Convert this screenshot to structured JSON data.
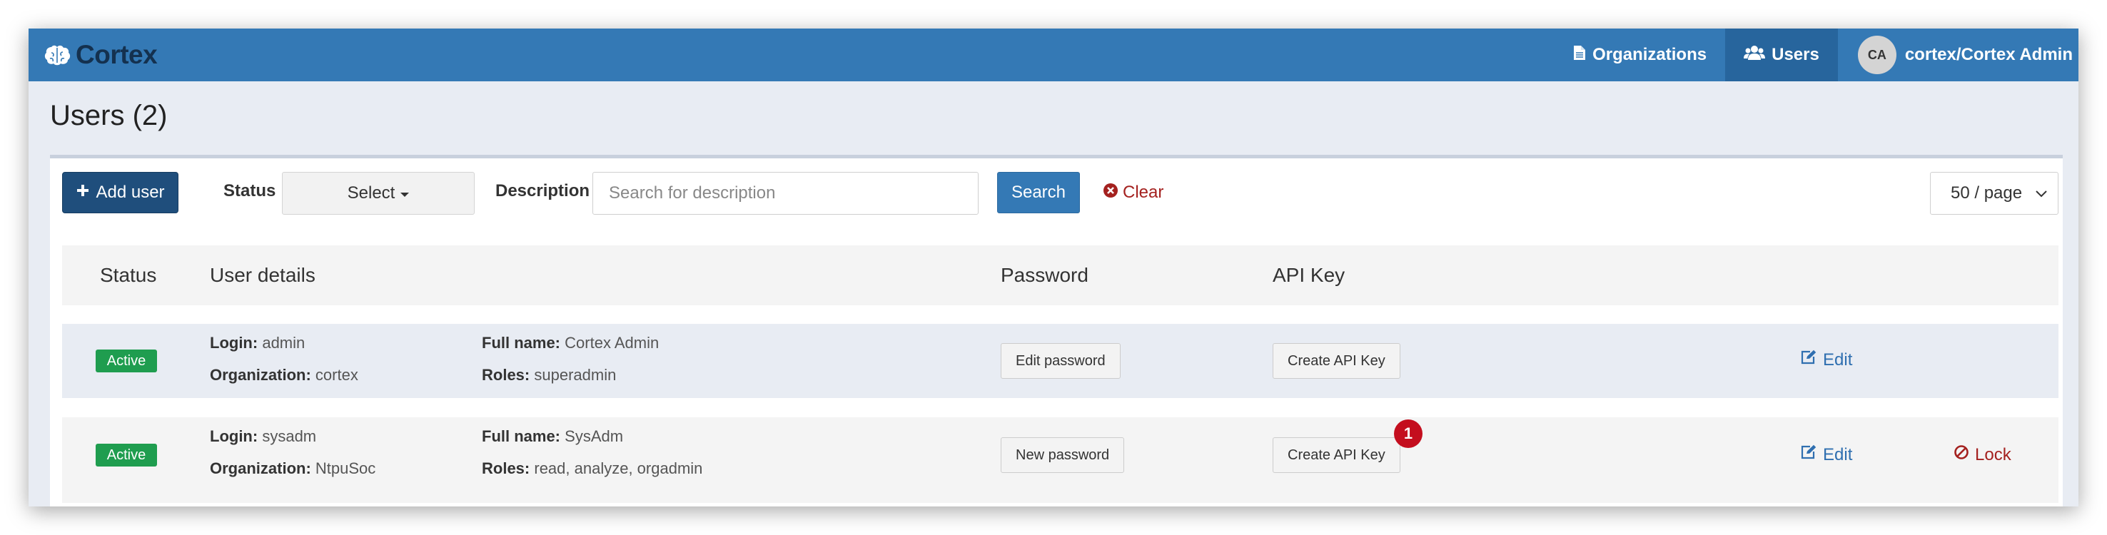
{
  "app": {
    "brand": "Cortex"
  },
  "nav": {
    "organizations": "Organizations",
    "users": "Users",
    "avatar_initials": "CA",
    "user_name": "cortex/Cortex Admin"
  },
  "page": {
    "title": "Users (2)"
  },
  "toolbar": {
    "add_user": "Add user",
    "status_label": "Status",
    "status_select": "Select",
    "description_label": "Description",
    "description_placeholder": "Search for description",
    "search": "Search",
    "clear": "Clear",
    "per_page": "50 / page"
  },
  "table": {
    "headers": {
      "status": "Status",
      "user_details": "User details",
      "password": "Password",
      "api_key": "API Key"
    },
    "field_labels": {
      "login": "Login:",
      "organization": "Organization:",
      "full_name": "Full name:",
      "roles": "Roles:"
    },
    "rows": [
      {
        "status": "Active",
        "login": "admin",
        "organization": "cortex",
        "full_name": "Cortex Admin",
        "roles": "superadmin",
        "password_action": "Edit password",
        "api_key_action": "Create API Key",
        "edit": "Edit"
      },
      {
        "status": "Active",
        "login": "sysadm",
        "organization": "NtpuSoc",
        "full_name": "SysAdm",
        "roles": "read, analyze, orgadmin",
        "password_action": "New password",
        "api_key_action": "Create API Key",
        "edit": "Edit",
        "lock": "Lock",
        "notification_count": "1"
      }
    ]
  },
  "colors": {
    "navbar": "#3479b5",
    "navbar_active": "#27659d",
    "primary_dark": "#1f4e7c",
    "active_badge": "#1f9d4f",
    "danger": "#a4211f",
    "link": "#2f6fb0",
    "notification": "#c40e1e"
  },
  "icons": {
    "brand": "brain-icon",
    "organizations": "file-icon",
    "users": "users-icon",
    "add": "plus-icon",
    "clear": "times-circle-icon",
    "edit": "edit-icon",
    "lock": "ban-icon",
    "select": "caret-down-icon",
    "per_page": "chevron-down-icon"
  }
}
